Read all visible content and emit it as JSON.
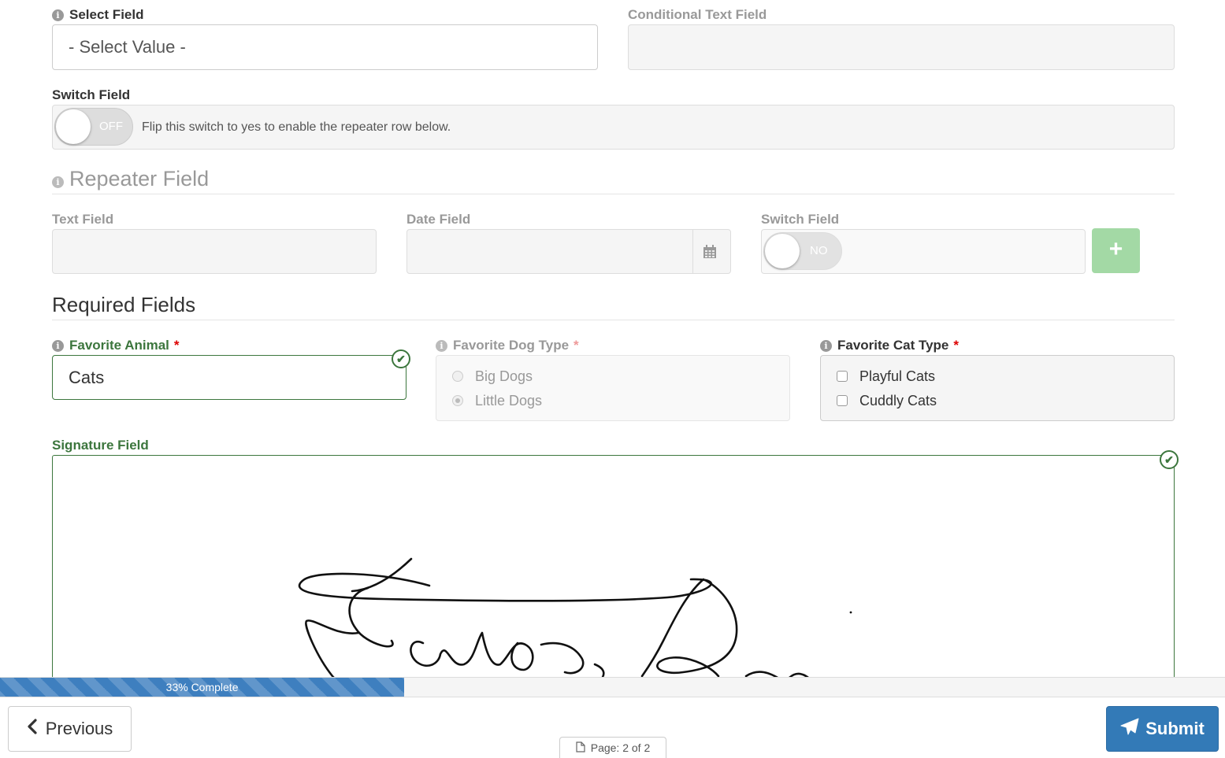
{
  "select_field": {
    "label": "Select Field",
    "value": "- Select Value -"
  },
  "conditional_text_field": {
    "label": "Conditional Text Field",
    "value": ""
  },
  "switch_field": {
    "label": "Switch Field",
    "state": "OFF",
    "help_text": "Flip this switch to yes to enable the repeater row below."
  },
  "repeater": {
    "title": "Repeater Field",
    "text_field_label": "Text Field",
    "date_field_label": "Date Field",
    "switch_field_label": "Switch Field",
    "switch_state": "NO",
    "add_label": "+"
  },
  "required_section": {
    "title": "Required Fields",
    "favorite_animal": {
      "label": "Favorite Animal",
      "required_mark": "*",
      "value": "Cats"
    },
    "favorite_dog_type": {
      "label": "Favorite Dog Type",
      "required_mark": "*",
      "options": [
        "Big Dogs",
        "Little Dogs"
      ],
      "selected": "Little Dogs"
    },
    "favorite_cat_type": {
      "label": "Favorite Cat Type",
      "required_mark": "*",
      "options": [
        "Playful Cats",
        "Cuddly Cats"
      ]
    },
    "signature_field": {
      "label": "Signature Field"
    }
  },
  "progress": {
    "percent": 33,
    "label": "33% Complete"
  },
  "footer": {
    "previous_label": "Previous",
    "submit_label": "Submit",
    "page_indicator": "Page: 2 of 2"
  },
  "colors": {
    "primary": "#337ab7",
    "success": "#3c763d",
    "required": "#dd0000",
    "add_button": "#a3d9a5"
  },
  "icons": {
    "info": "info-circle-icon",
    "calendar": "calendar-icon",
    "check": "check-circle-icon",
    "previous": "chevron-left-icon",
    "submit": "paper-plane-icon",
    "page": "file-icon"
  }
}
